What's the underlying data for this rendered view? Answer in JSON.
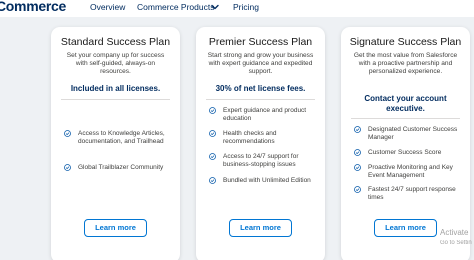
{
  "header": {
    "brand": "Commerce",
    "nav": [
      "Overview",
      "Commerce Products",
      "Pricing"
    ]
  },
  "cards": [
    {
      "title": "Standard Success Plan",
      "subtitle": "Set your company up for success with self-guided, always-on resources.",
      "highlight": "Included in all licenses.",
      "features": [
        "Access to Knowledge Articles, documentation, and Trailhead",
        "Global Trailblazer Community"
      ],
      "button": "Learn more"
    },
    {
      "title": "Premier Success Plan",
      "subtitle": "Start strong and grow your business with expert guidance and expedited support.",
      "highlight": "30% of net license fees.",
      "features": [
        "Expert guidance and product education",
        "Health checks and recommendations",
        "Access to 24/7 support for business-stopping issues",
        "Bundled with Unlimited Edition"
      ],
      "button": "Learn more"
    },
    {
      "title": "Signature Success Plan",
      "subtitle": "Get the most value from Salesforce with a proactive partnership and personalized experience.",
      "highlight": "Contact your account executive.",
      "features": [
        "Designated Customer Success Manager",
        "Customer Success Score",
        "Proactive Monitoring and Key Event Management",
        "Fastest 24/7 support response times"
      ],
      "button": "Learn more"
    }
  ],
  "watermark": {
    "line1": "Activate",
    "line2": "Go to Settin"
  },
  "colors": {
    "brand_navy": "#032d60",
    "accent_blue": "#0176d3",
    "check_blue": "#0b5cab",
    "background": "#eef1f4"
  },
  "icons": {
    "feature": "check-circle-icon",
    "dropdown": "chevron-down-icon"
  }
}
